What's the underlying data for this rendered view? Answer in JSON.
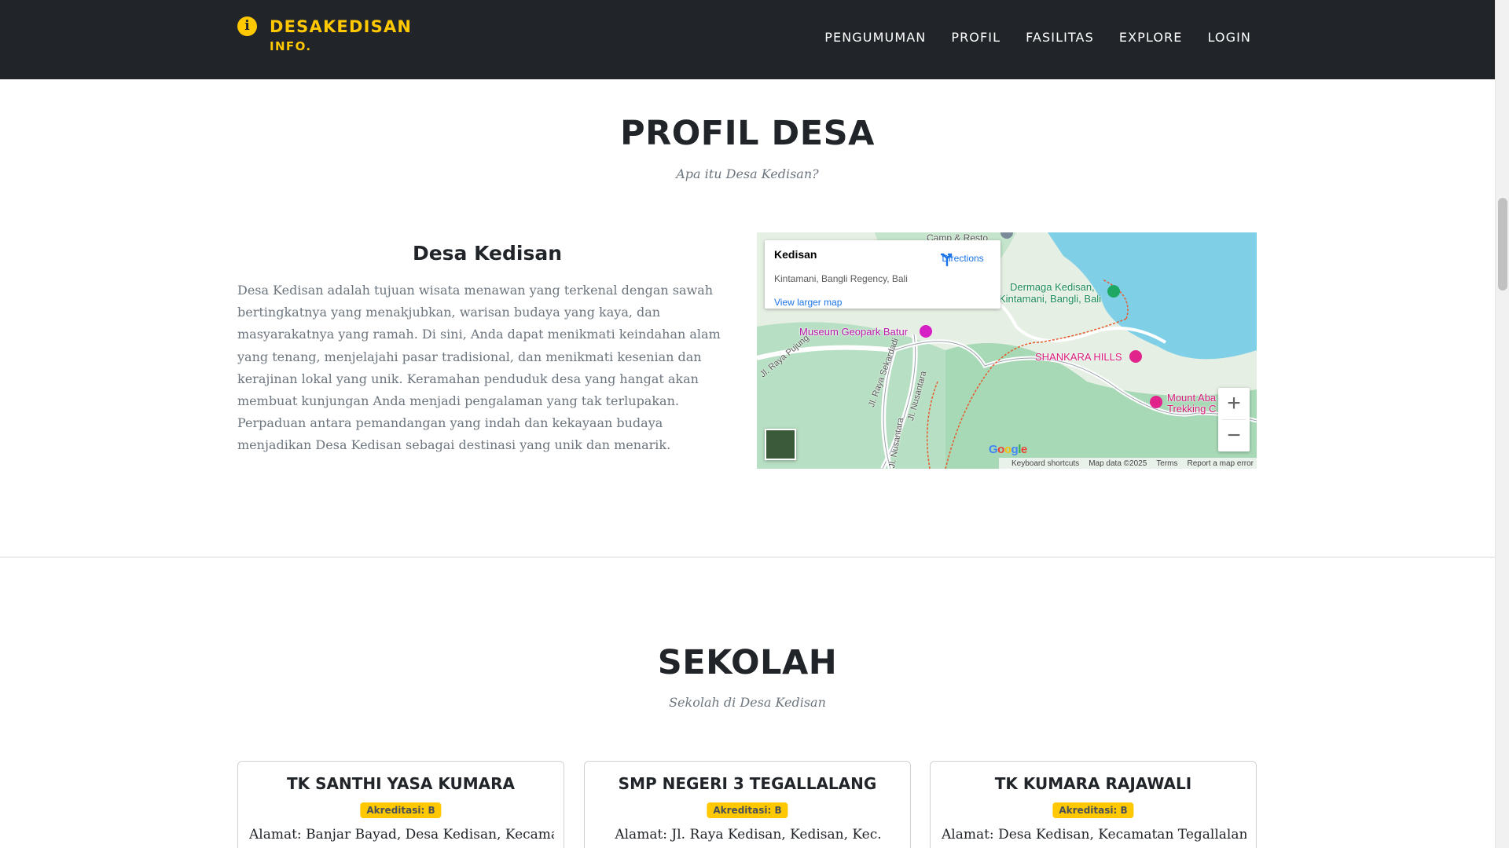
{
  "navbar": {
    "brand_name": "DESAKEDISAN",
    "brand_sub": "INFO.",
    "brand_icon": "info-circle-icon",
    "links": [
      "PENGUMUMAN",
      "PROFIL",
      "FASILITAS",
      "EXPLORE",
      "LOGIN"
    ],
    "accent_color": "#ffc800",
    "background_color": "#212529"
  },
  "profile": {
    "heading": "PROFIL DESA",
    "subheading": "Apa itu Desa Kedisan?",
    "title": "Desa Kedisan",
    "description": "Desa Kedisan adalah tujuan wisata menawan yang terkenal dengan sawah bertingkatnya yang menakjubkan, warisan budaya yang kaya, dan masyarakatnya yang ramah. Di sini, Anda dapat menikmati keindahan alam yang tenang, menjelajahi pasar tradisional, dan menikmati kesenian dan kerajinan lokal yang unik. Keramahan penduduk desa yang hangat akan membuat kunjungan Anda menjadi pengalaman yang tak terlupakan. Perpaduan antara pemandangan yang indah dan kekayaan budaya menjadikan Desa Kedisan sebagai destinasi yang unik dan menarik."
  },
  "map": {
    "place_name": "Kedisan",
    "place_address": "Kintamani, Bangli Regency, Bali",
    "directions_label": "Directions",
    "view_larger": "View larger map",
    "labels": {
      "camp": "Camp & Resto",
      "dermaga_1": "Dermaga Kedisan,",
      "dermaga_2": "Kintamani, Bangli, Bali",
      "museum": "Museum Geopark Batur",
      "shankara": "SHANKARA HILLS",
      "mount_1": "Mount Aba",
      "mount_2": "Trekking C",
      "road_1": "Jl. Raya Sekardadi",
      "road_2": "Jl. Nusantara",
      "road_3": "Jl. Raya Pujung",
      "road_4": "Jl. Nusantara"
    },
    "google": "Google",
    "footer": [
      "Keyboard shortcuts",
      "Map data ©2025",
      "Terms",
      "Report a map error"
    ],
    "zoom_in": "+",
    "zoom_out": "−"
  },
  "schools": {
    "heading": "SEKOLAH",
    "subheading": "Sekolah di Desa Kedisan",
    "items": [
      {
        "name": "TK SANTHI YASA KUMARA",
        "badge": "Akreditasi: B",
        "address": "Alamat: Banjar Bayad, Desa Kedisan, Kecamatan"
      },
      {
        "name": "SMP NEGERI 3 TEGALLALANG",
        "badge": "Akreditasi: B",
        "address": "Alamat: Jl. Raya Kedisan, Kedisan, Kec."
      },
      {
        "name": "TK KUMARA RAJAWALI",
        "badge": "Akreditasi: B",
        "address": "Alamat: Desa Kedisan, Kecamatan Tegallalang,"
      }
    ]
  }
}
